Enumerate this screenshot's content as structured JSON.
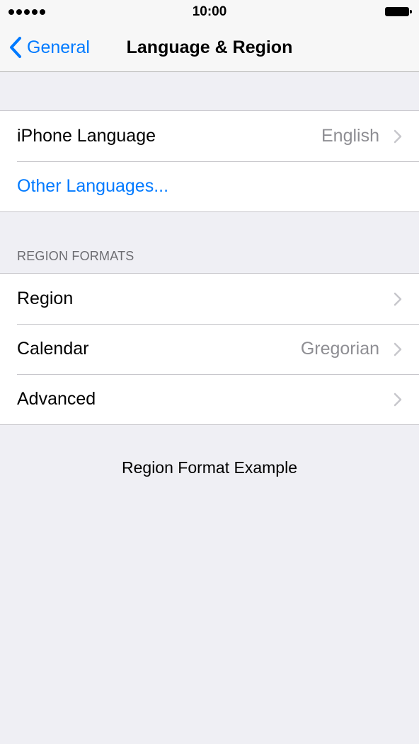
{
  "status_bar": {
    "time": "10:00",
    "signal_dots": 5,
    "signal_icon": "signal-dots-icon",
    "battery_icon": "battery-icon"
  },
  "nav": {
    "back_label": "General",
    "back_icon": "chevron-left-icon",
    "title": "Language & Region"
  },
  "language_group": {
    "items": [
      {
        "label": "iPhone Language",
        "value": "English",
        "chevron": true
      },
      {
        "label": "Other Languages...",
        "link": true
      }
    ]
  },
  "region_section": {
    "header": "REGION FORMATS",
    "items": [
      {
        "label": "Region",
        "value": "",
        "chevron": true
      },
      {
        "label": "Calendar",
        "value": "Gregorian",
        "chevron": true
      },
      {
        "label": "Advanced",
        "value": "",
        "chevron": true
      }
    ]
  },
  "example": {
    "title": "Region Format Example"
  },
  "colors": {
    "accent": "#007aff",
    "background": "#efeff4",
    "secondary_text": "#8e8e93",
    "separator": "#c8c7cc"
  }
}
